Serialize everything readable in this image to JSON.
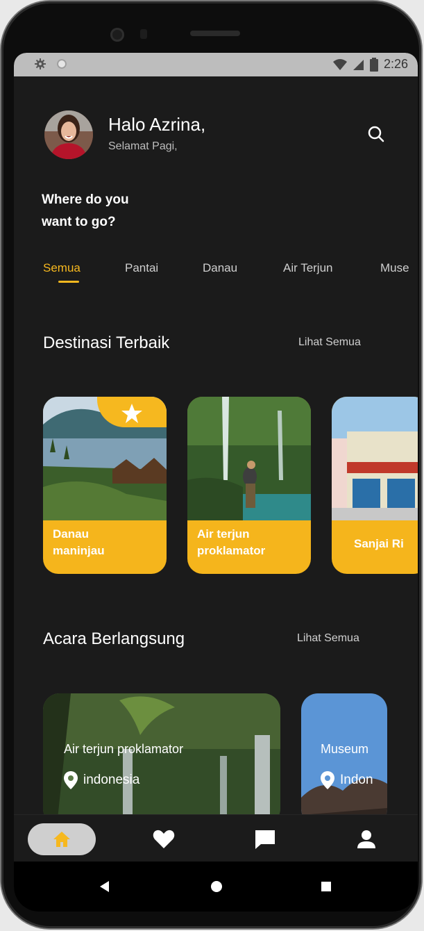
{
  "status_bar": {
    "time": "2:26"
  },
  "header": {
    "greeting": "Halo Azrina,",
    "subtitle": "Selamat Pagi,",
    "question_line1": "Where do you",
    "question_line2": "want to go?"
  },
  "categories": [
    {
      "label": "Semua",
      "active": true
    },
    {
      "label": "Pantai",
      "active": false
    },
    {
      "label": "Danau",
      "active": false
    },
    {
      "label": "Air Terjun",
      "active": false
    },
    {
      "label": "Muse",
      "active": false
    }
  ],
  "best_destinations": {
    "title": "Destinasi Terbaik",
    "see_all": "Lihat Semua",
    "items": [
      {
        "name_line1": "Danau",
        "name_line2": "maninjau",
        "featured": true
      },
      {
        "name_line1": "Air terjun",
        "name_line2": "proklamator",
        "featured": false
      },
      {
        "name_line1": "Sanjai Ri",
        "name_line2": "",
        "featured": false
      }
    ]
  },
  "ongoing_events": {
    "title": "Acara Berlangsung",
    "see_all": "Lihat Semua",
    "items": [
      {
        "name": "Air terjun proklamator",
        "location": "indonesia"
      },
      {
        "name": "Museum",
        "location": "Indon"
      }
    ]
  },
  "bottom_nav": {
    "items": [
      "home-icon",
      "heart-icon",
      "chat-icon",
      "profile-icon"
    ],
    "active": "home-icon"
  },
  "colors": {
    "accent": "#f6b81f",
    "background": "#1b1b1b"
  }
}
